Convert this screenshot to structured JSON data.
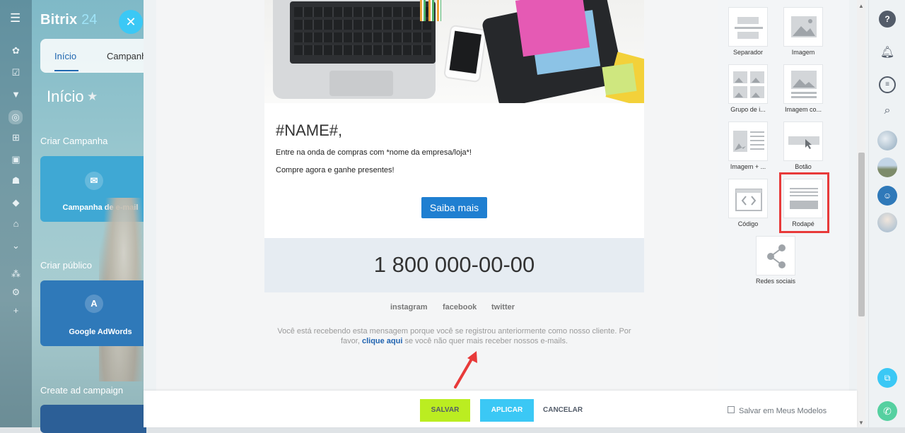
{
  "app": {
    "logo_main": "Bitrix",
    "logo_num": "24",
    "tabs": [
      {
        "label": "Início"
      },
      {
        "label": "Campanh"
      }
    ],
    "page_title": "Início",
    "sections": [
      {
        "label": "Criar Campanha"
      },
      {
        "label": "Criar público"
      },
      {
        "label": "Create ad campaign"
      }
    ],
    "tiles": [
      {
        "label": "Campanha de e-mail",
        "icon": "mail-icon"
      },
      {
        "label": "Google AdWords",
        "icon": "adwords-icon"
      }
    ]
  },
  "email": {
    "heading": "#NAME#,",
    "line1": "Entre na onda de compras com *nome da empresa/loja*!",
    "line2": "Compre agora e ganhe presentes!",
    "cta_label": "Saiba mais",
    "phone": "1 800 000-00-00",
    "social": [
      {
        "label": "instagram"
      },
      {
        "label": "facebook"
      },
      {
        "label": "twitter"
      }
    ],
    "footer_before": "Você está recebendo esta mensagem porque você se registrou anteriormente como nosso cliente. Por favor,",
    "footer_link": "clique aqui",
    "footer_after": "se você não quer mais receber nossos e-mails."
  },
  "blocks": [
    {
      "label": "Separador"
    },
    {
      "label": "Imagem"
    },
    {
      "label": "Grupo de i..."
    },
    {
      "label": "Imagem co..."
    },
    {
      "label": "Imagem + ..."
    },
    {
      "label": "Botão"
    },
    {
      "label": "Código"
    },
    {
      "label": "Rodapé"
    },
    {
      "label": "Redes sociais"
    }
  ],
  "footer_bar": {
    "save": "SALVAR",
    "apply": "APLICAR",
    "cancel": "CANCELAR",
    "save_template": "Salvar em Meus Modelos"
  },
  "colors": {
    "accent": "#3bc8f5",
    "save_green": "#bbed21",
    "cta_blue": "#1f7fd1",
    "highlight_red": "#e83a3a"
  }
}
